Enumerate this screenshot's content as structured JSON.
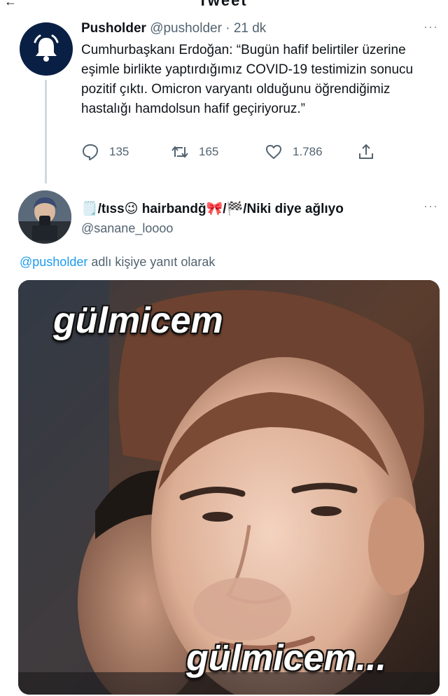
{
  "header": {
    "title": "Tweet",
    "back_icon": "arrow-left-icon"
  },
  "tweet": {
    "name": "Pusholder",
    "handle": "@pusholder",
    "separator": "·",
    "time": "21 dk",
    "more": "···",
    "avatar_icon": "bell-icon",
    "text": "Cumhurbaşkanı Erdoğan: “Bugün hafif belirtiler üzerine eşimle birlikte yaptırdığımız COVID-19 testimizin sonucu pozitif çıktı. Omicron varyantı olduğunu öğrendiğimiz hastalığı hamdolsun hafif geçiriyoruz.”",
    "actions": {
      "replies": "135",
      "retweets": "165",
      "likes": "1.786"
    }
  },
  "reply": {
    "name": "🗒️/tıss😉 hairbandğ🎀/🏁/Niki diye ağlıyo",
    "handle": "@sanane_loooo",
    "more": "···",
    "replying_to_mention": "@pusholder",
    "replying_to_suffix": " adlı kişiye yanıt olarak",
    "media": {
      "caption_top": "gülmicem",
      "caption_bottom": "gülmicem..."
    }
  },
  "colors": {
    "accent": "#1d9bf0",
    "muted": "#536471",
    "avatar_bg": "#0a1f44"
  }
}
